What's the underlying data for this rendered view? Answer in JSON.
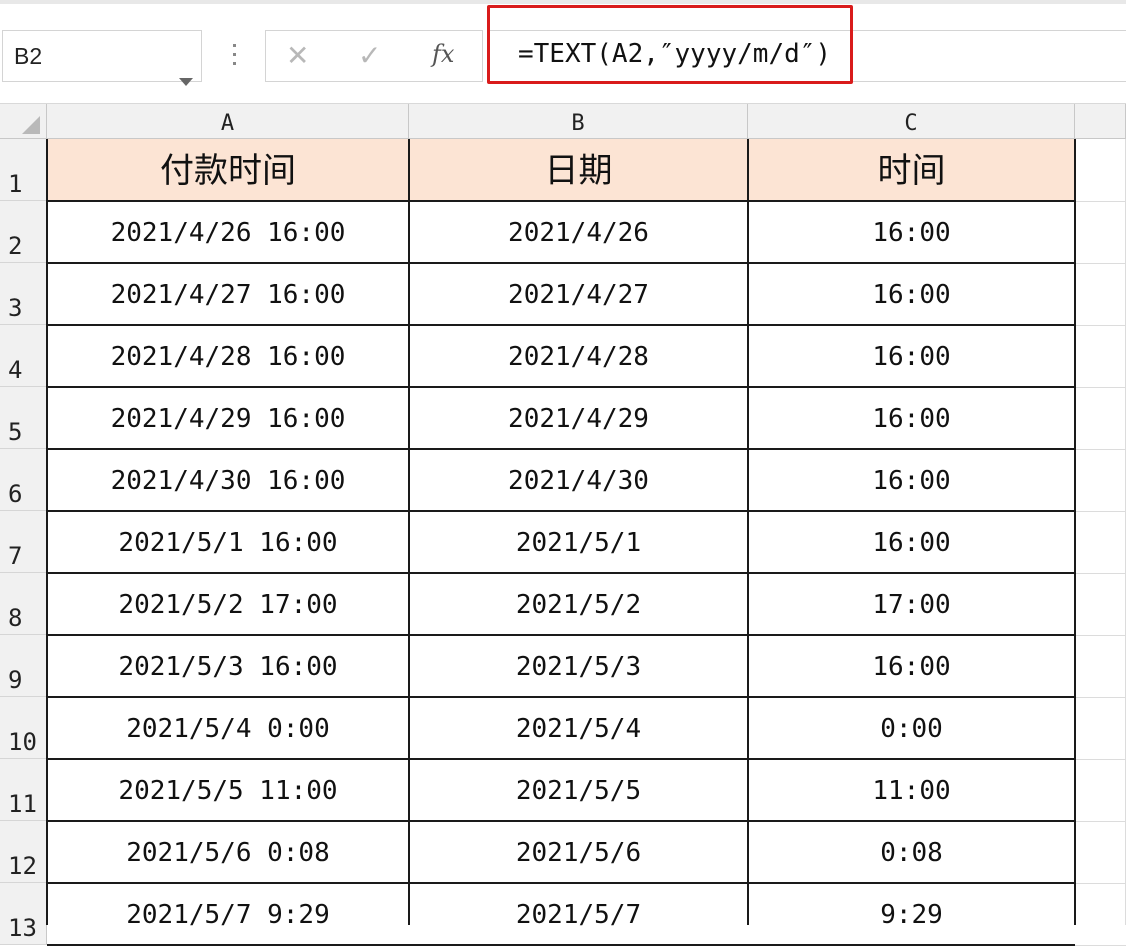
{
  "formula_bar": {
    "name_box": "B2",
    "cancel_icon": "close-icon",
    "enter_icon": "check-icon",
    "fx_label": "fx",
    "formula": "=TEXT(A2,″yyyy/m/d″)"
  },
  "columns": [
    "A",
    "B",
    "C"
  ],
  "rows": [
    "1",
    "2",
    "3",
    "4",
    "5",
    "6",
    "7",
    "8",
    "9",
    "10",
    "11",
    "12",
    "13"
  ],
  "header_row": [
    "付款时间",
    "日期",
    "时间"
  ],
  "data_rows": [
    [
      "2021/4/26 16:00",
      "2021/4/26",
      "16:00"
    ],
    [
      "2021/4/27 16:00",
      "2021/4/27",
      "16:00"
    ],
    [
      "2021/4/28 16:00",
      "2021/4/28",
      "16:00"
    ],
    [
      "2021/4/29 16:00",
      "2021/4/29",
      "16:00"
    ],
    [
      "2021/4/30 16:00",
      "2021/4/30",
      "16:00"
    ],
    [
      "2021/5/1 16:00",
      "2021/5/1",
      "16:00"
    ],
    [
      "2021/5/2 17:00",
      "2021/5/2",
      "17:00"
    ],
    [
      "2021/5/3 16:00",
      "2021/5/3",
      "16:00"
    ],
    [
      "2021/5/4 0:00",
      "2021/5/4",
      "0:00"
    ],
    [
      "2021/5/5 11:00",
      "2021/5/5",
      "11:00"
    ],
    [
      "2021/5/6 0:08",
      "2021/5/6",
      "0:08"
    ],
    [
      "2021/5/7 9:29",
      "2021/5/7",
      "9:29"
    ]
  ],
  "colors": {
    "header_fill": "#fce4d4",
    "highlight": "#d91b1b"
  }
}
